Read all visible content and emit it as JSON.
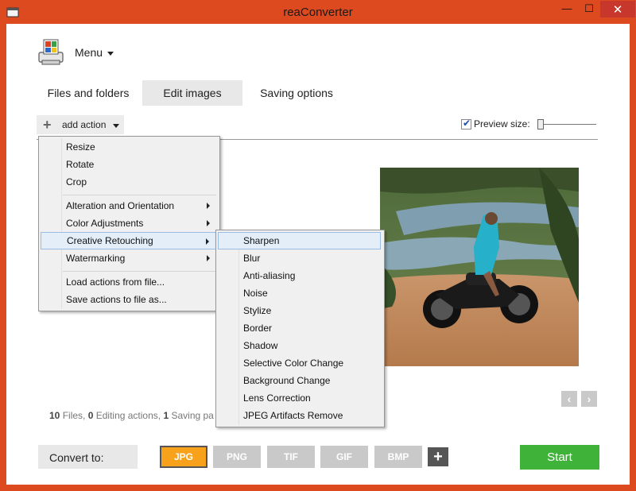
{
  "window": {
    "title": "reaConverter",
    "minimize": "—",
    "maximize": "☐",
    "close": "✕"
  },
  "app_menu": {
    "label": "Menu"
  },
  "tabs": [
    {
      "label": "Files and folders",
      "active": false
    },
    {
      "label": "Edit images",
      "active": true
    },
    {
      "label": "Saving options",
      "active": false
    }
  ],
  "toolbar": {
    "add_action": "add action",
    "preview_label": "Preview size:",
    "preview_checked": true
  },
  "action_menu": {
    "items": [
      "Resize",
      "Rotate",
      "Crop",
      "Alteration and Orientation",
      "Color Adjustments",
      "Creative Retouching",
      "Watermarking",
      "Load actions from file...",
      "Save actions to file as..."
    ],
    "highlighted": "Creative Retouching"
  },
  "submenu": {
    "items": [
      "Sharpen",
      "Blur",
      "Anti-aliasing",
      "Noise",
      "Stylize",
      "Border",
      "Shadow",
      "Selective Color Change",
      "Background Change",
      "Lens Correction",
      "JPEG Artifacts Remove"
    ],
    "highlighted": "Sharpen"
  },
  "status": {
    "files_count": "10",
    "files_label": " Files, ",
    "actions_count": "0",
    "actions_label": " Editing actions, ",
    "saving_count": "1",
    "saving_label": " Saving pa"
  },
  "convert": {
    "label": "Convert to:",
    "formats": [
      "JPG",
      "PNG",
      "TIF",
      "GIF",
      "BMP"
    ],
    "selected": "JPG",
    "add": "+"
  },
  "start": {
    "label": "Start"
  },
  "colors": {
    "accent": "#f7a21a",
    "start": "#3fb23a",
    "titlebar": "#de4a1f",
    "close": "#c7372b"
  }
}
